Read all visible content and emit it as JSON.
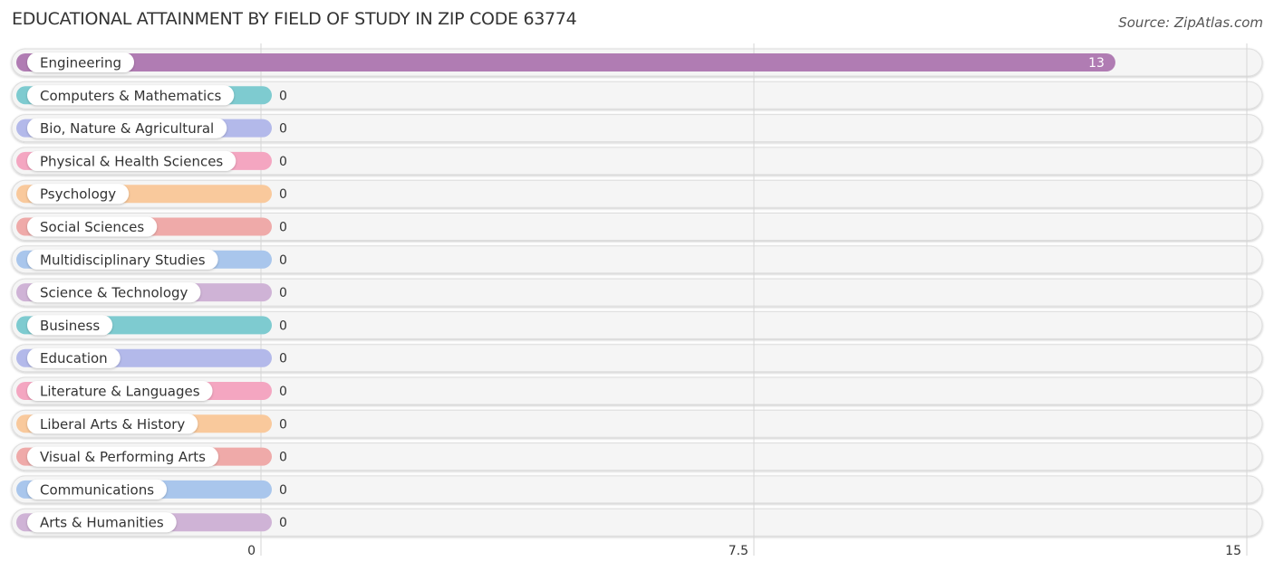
{
  "header": {
    "title": "EDUCATIONAL ATTAINMENT BY FIELD OF STUDY IN ZIP CODE 63774",
    "source": "Source: ZipAtlas.com"
  },
  "chart_data": {
    "type": "bar",
    "orientation": "horizontal",
    "title": "EDUCATIONAL ATTAINMENT BY FIELD OF STUDY IN ZIP CODE 63774",
    "xlabel": "",
    "ylabel": "",
    "xlim": [
      0,
      15
    ],
    "xticks": [
      0,
      7.5,
      15
    ],
    "xtick_labels": [
      "0",
      "7.5",
      "15"
    ],
    "grid": true,
    "categories": [
      "Engineering",
      "Computers & Mathematics",
      "Bio, Nature & Agricultural",
      "Physical & Health Sciences",
      "Psychology",
      "Social Sciences",
      "Multidisciplinary Studies",
      "Science & Technology",
      "Business",
      "Education",
      "Literature & Languages",
      "Liberal Arts & History",
      "Visual & Performing Arts",
      "Communications",
      "Arts & Humanities"
    ],
    "values": [
      13,
      0,
      0,
      0,
      0,
      0,
      0,
      0,
      0,
      0,
      0,
      0,
      0,
      0,
      0
    ],
    "colors": [
      "#b07cb3",
      "#7ecbd0",
      "#b3b9ea",
      "#f4a6c1",
      "#f9c99c",
      "#efaaa9",
      "#a9c6ec",
      "#cfb3d6",
      "#7ecbd0",
      "#b3b9ea",
      "#f4a6c1",
      "#f9c99c",
      "#efaaa9",
      "#a9c6ec",
      "#cfb3d6"
    ]
  }
}
